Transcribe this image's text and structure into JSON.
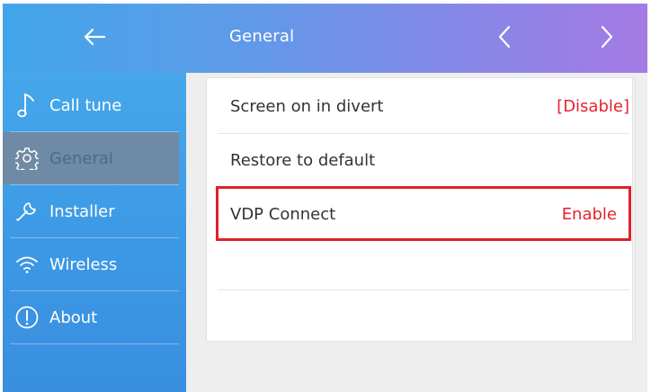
{
  "header": {
    "title": "General",
    "back_icon": "arrow-left-icon",
    "prev_icon": "chevron-left-icon",
    "next_icon": "chevron-right-icon"
  },
  "sidebar": {
    "items": [
      {
        "label": "Call tune",
        "icon": "music-note-icon",
        "active": false
      },
      {
        "label": "General",
        "icon": "gear-icon",
        "active": true
      },
      {
        "label": "Installer",
        "icon": "wrench-icon",
        "active": false
      },
      {
        "label": "Wireless",
        "icon": "wifi-icon",
        "active": false
      },
      {
        "label": "About",
        "icon": "info-icon",
        "active": false
      }
    ]
  },
  "settings": {
    "rows": [
      {
        "title": "Screen on in divert",
        "value": "[Disable]"
      },
      {
        "title": "Restore to default",
        "value": ""
      },
      {
        "title": "VDP Connect",
        "value": "Enable"
      }
    ]
  },
  "colors": {
    "accent_red": "#e8212a",
    "sidebar_blue": "#3c97e4",
    "header_gradient_start": "#42a6ea",
    "header_gradient_end": "#a47be4"
  }
}
